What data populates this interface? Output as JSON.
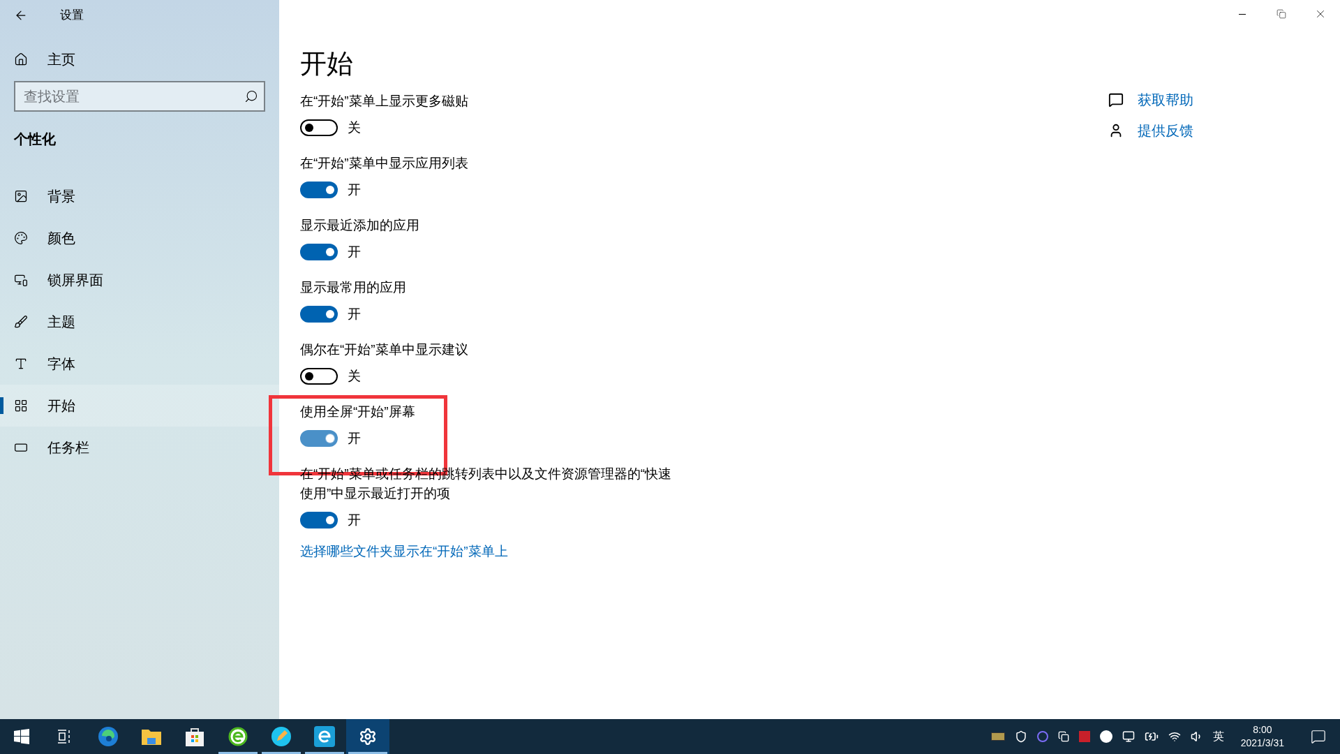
{
  "window": {
    "title": "设置"
  },
  "sidebar": {
    "home": "主页",
    "search": {
      "placeholder": "查找设置"
    },
    "section": "个性化",
    "items": [
      {
        "label": "背景",
        "selected": false
      },
      {
        "label": "颜色",
        "selected": false
      },
      {
        "label": "锁屏界面",
        "selected": false
      },
      {
        "label": "主题",
        "selected": false
      },
      {
        "label": "字体",
        "selected": false
      },
      {
        "label": "开始",
        "selected": true
      },
      {
        "label": "任务栏",
        "selected": false
      }
    ]
  },
  "page": {
    "title": "开始",
    "settings": [
      {
        "label": "在“开始”菜单上显示更多磁贴",
        "on": false,
        "state_text": "关",
        "hovered": false,
        "annotated": false
      },
      {
        "label": "在“开始”菜单中显示应用列表",
        "on": true,
        "state_text": "开",
        "hovered": false,
        "annotated": false
      },
      {
        "label": "显示最近添加的应用",
        "on": true,
        "state_text": "开",
        "hovered": false,
        "annotated": false
      },
      {
        "label": "显示最常用的应用",
        "on": true,
        "state_text": "开",
        "hovered": false,
        "annotated": false
      },
      {
        "label": "偶尔在“开始”菜单中显示建议",
        "on": false,
        "state_text": "关",
        "hovered": false,
        "annotated": false
      },
      {
        "label": "使用全屏“开始”屏幕",
        "on": true,
        "state_text": "开",
        "hovered": true,
        "annotated": true
      },
      {
        "label": "在“开始”菜单或任务栏的跳转列表中以及文件资源管理器的“快速使用”中显示最近打开的项",
        "on": true,
        "state_text": "开",
        "hovered": false,
        "annotated": false
      }
    ],
    "link": "选择哪些文件夹显示在“开始”菜单上"
  },
  "help": [
    {
      "label": "获取帮助"
    },
    {
      "label": "提供反馈"
    }
  ],
  "taskbar": {
    "apps": [
      {
        "running": false,
        "active": false
      },
      {
        "running": false,
        "active": false
      },
      {
        "running": false,
        "active": false
      },
      {
        "running": false,
        "active": false
      },
      {
        "running": false,
        "active": false
      },
      {
        "running": true,
        "active": false
      },
      {
        "running": true,
        "active": false
      },
      {
        "running": true,
        "active": false
      },
      {
        "running": true,
        "active": true
      }
    ],
    "ime": "英",
    "time": "8:00",
    "date": "2021/3/31"
  }
}
